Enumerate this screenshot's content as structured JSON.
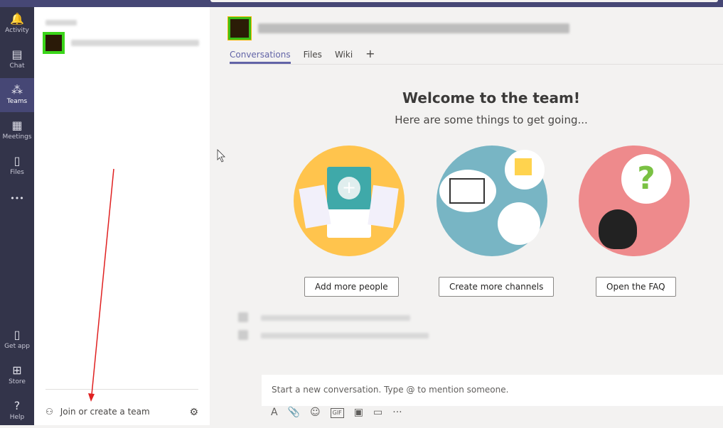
{
  "rail": [
    {
      "label": "Activity",
      "icon": "bell-icon",
      "glyph": "🔔"
    },
    {
      "label": "Chat",
      "icon": "chat-icon",
      "glyph": "▤"
    },
    {
      "label": "Teams",
      "icon": "teams-icon",
      "glyph": "⁂",
      "selected": true
    },
    {
      "label": "Meetings",
      "icon": "calendar-icon",
      "glyph": "▦"
    },
    {
      "label": "Files",
      "icon": "file-icon",
      "glyph": "▯"
    },
    {
      "label": "",
      "icon": "more-icon",
      "glyph": "•••"
    },
    {
      "label": "Get app",
      "icon": "device-icon",
      "glyph": "▯"
    },
    {
      "label": "Store",
      "icon": "store-icon",
      "glyph": "⊞"
    },
    {
      "label": "Help",
      "icon": "help-icon",
      "glyph": "?"
    }
  ],
  "panel": {
    "join_label": "Join or create a team"
  },
  "main": {
    "tabs": [
      "Conversations",
      "Files",
      "Wiki"
    ],
    "welcome": "Welcome to the team!",
    "subtitle": "Here are some things to get going...",
    "buttons": [
      "Add more people",
      "Create more channels",
      "Open the FAQ"
    ],
    "compose_placeholder": "Start a new conversation. Type @ to mention someone.",
    "tools": [
      "A",
      "📎",
      "☺",
      "GIF",
      "▣",
      "▭",
      "···"
    ]
  },
  "colors": {
    "accent": "#6264a7",
    "rail": "#33344a",
    "annotation": "#e02020"
  }
}
